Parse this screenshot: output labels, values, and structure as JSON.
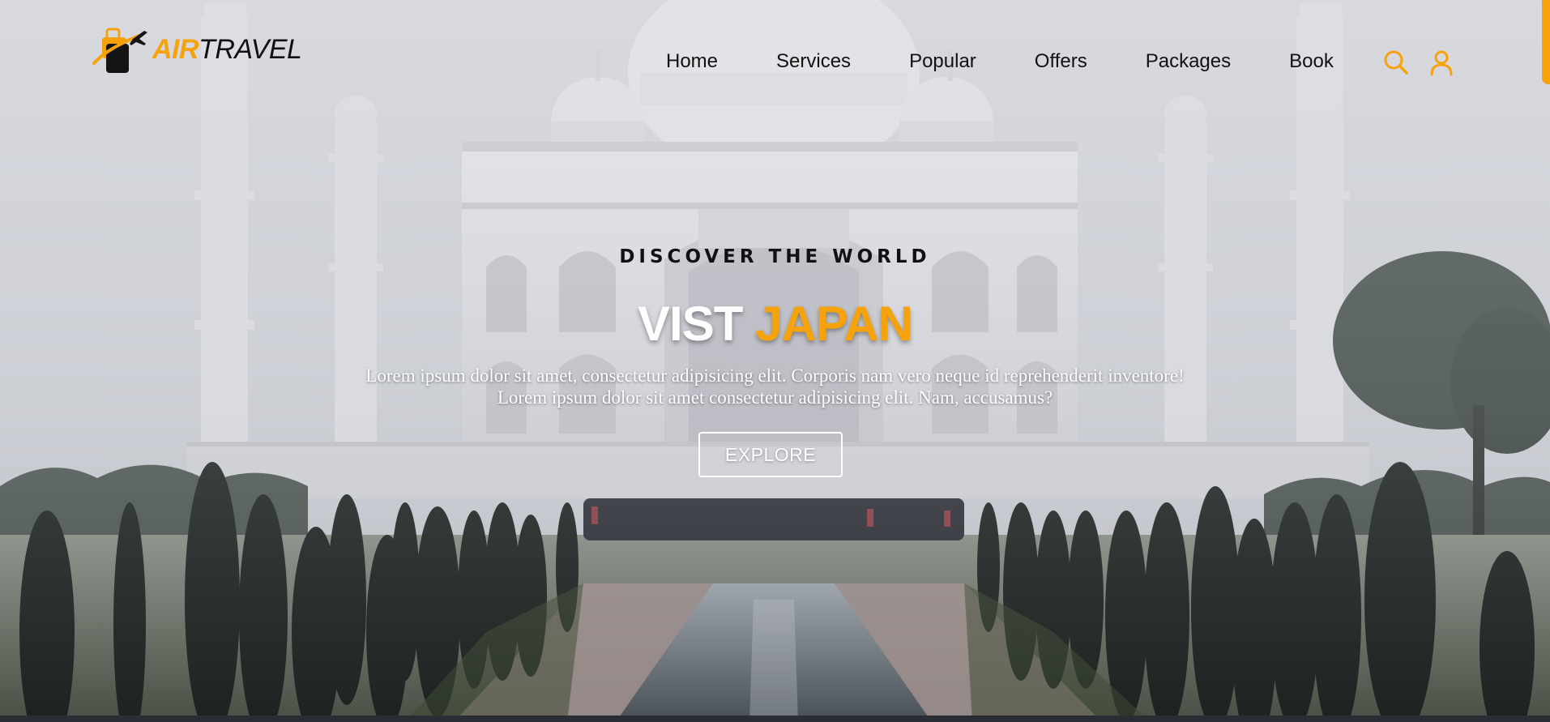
{
  "brand": {
    "name_part1": "AIR",
    "name_part2": "TRAVEL",
    "accent": "#f5a20b",
    "logo_icon": "suitcase-plane-icon"
  },
  "nav": {
    "items": [
      {
        "label": "Home"
      },
      {
        "label": "Services"
      },
      {
        "label": "Popular"
      },
      {
        "label": "Offers"
      },
      {
        "label": "Packages"
      },
      {
        "label": "Book"
      }
    ],
    "icons": [
      "search-icon",
      "user-icon"
    ]
  },
  "hero": {
    "eyebrow": "DISCOVER THE WORLD",
    "headline_word1": "VIST",
    "headline_word2": "JAPAN",
    "lead_line1": "Lorem ipsum dolor sit amet, consectetur adipisicing elit. Corporis nam vero neque id reprehenderit inventore!",
    "lead_line2": "Lorem ipsum dolor sit amet consectetur adipisicing elit. Nam, accusamus?",
    "cta_label": "EXPLORE",
    "background": "taj-mahal-photo"
  },
  "colors": {
    "accent": "#f5a20b",
    "text_dark": "#111111",
    "text_light": "#ffffff"
  }
}
